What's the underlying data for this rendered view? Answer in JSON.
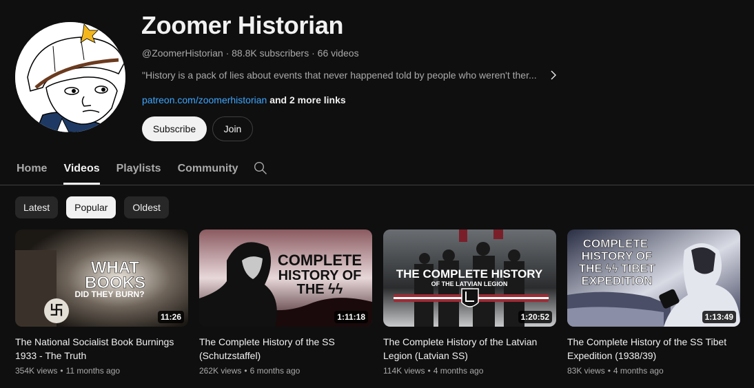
{
  "channel": {
    "name": "Zoomer Historian",
    "handle": "@ZoomerHistorian",
    "subscribers": "88.8K subscribers",
    "videos_count": "66 videos",
    "separator": "·",
    "description": "\"History is a pack of lies about events that never happened told by people who weren't ther...",
    "link_text": "patreon.com/zoomerhistorian",
    "more_links": "and 2 more links",
    "subscribe_label": "Subscribe",
    "join_label": "Join",
    "colors": {
      "link": "#3ea6ff",
      "background": "#0f0f0f"
    }
  },
  "tabs": [
    {
      "label": "Home",
      "active": false
    },
    {
      "label": "Videos",
      "active": true
    },
    {
      "label": "Playlists",
      "active": false
    },
    {
      "label": "Community",
      "active": false
    }
  ],
  "tab_search_icon": "search-icon",
  "chips": [
    {
      "label": "Latest",
      "active": false
    },
    {
      "label": "Popular",
      "active": true
    },
    {
      "label": "Oldest",
      "active": false
    }
  ],
  "videos": [
    {
      "title": "The National Socialist Book Burnings 1933 - The Truth",
      "views": "354K views",
      "age": "11 months ago",
      "duration": "11:26",
      "thumb_text": [
        "WHAT",
        "BOOKS",
        "DID THEY BURN?"
      ]
    },
    {
      "title": "The Complete History of the SS (Schutzstaffel)",
      "views": "262K views",
      "age": "6 months ago",
      "duration": "1:11:18",
      "thumb_text": [
        "COMPLETE",
        "HISTORY OF",
        "THE ϟϟ"
      ]
    },
    {
      "title": "The Complete History of the Latvian Legion (Latvian SS)",
      "views": "114K views",
      "age": "4 months ago",
      "duration": "1:20:52",
      "thumb_text": [
        "THE COMPLETE HISTORY",
        "OF THE LATVIAN LEGION"
      ]
    },
    {
      "title": "The Complete History of the SS Tibet Expedition (1938/39)",
      "views": "83K views",
      "age": "4 months ago",
      "duration": "1:13:49",
      "thumb_text": [
        "COMPLETE",
        "HISTORY OF",
        "THE ϟϟ TIBET",
        "EXPEDITION"
      ]
    }
  ],
  "meta_dot": "•"
}
